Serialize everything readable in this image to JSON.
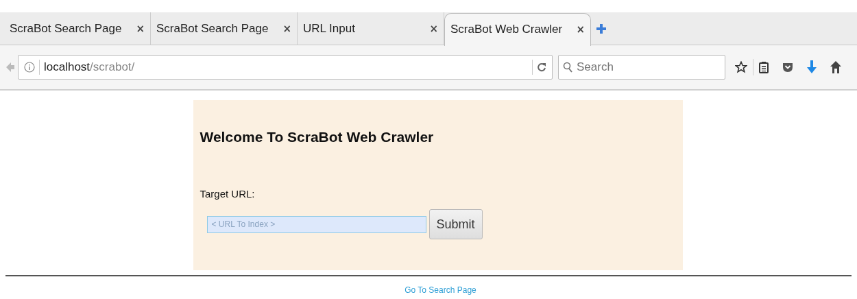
{
  "browser": {
    "tabs": [
      {
        "title": "ScraBot Search Page",
        "close": "×",
        "selected": false
      },
      {
        "title": "ScraBot Search Page",
        "close": "×",
        "selected": false
      },
      {
        "title": "URL Input",
        "close": "×",
        "selected": false
      },
      {
        "title": "ScraBot Web Crawler",
        "close": "×",
        "selected": true
      }
    ],
    "address": {
      "host": "localhost",
      "path": "/scrabot/"
    },
    "search": {
      "placeholder": "Search"
    }
  },
  "page": {
    "heading": "Welcome To ScraBot Web Crawler",
    "label": "Target URL:",
    "url_field": {
      "placeholder": "< URL To Index >"
    },
    "submit": "Submit",
    "link": "Go To Search Page"
  }
}
